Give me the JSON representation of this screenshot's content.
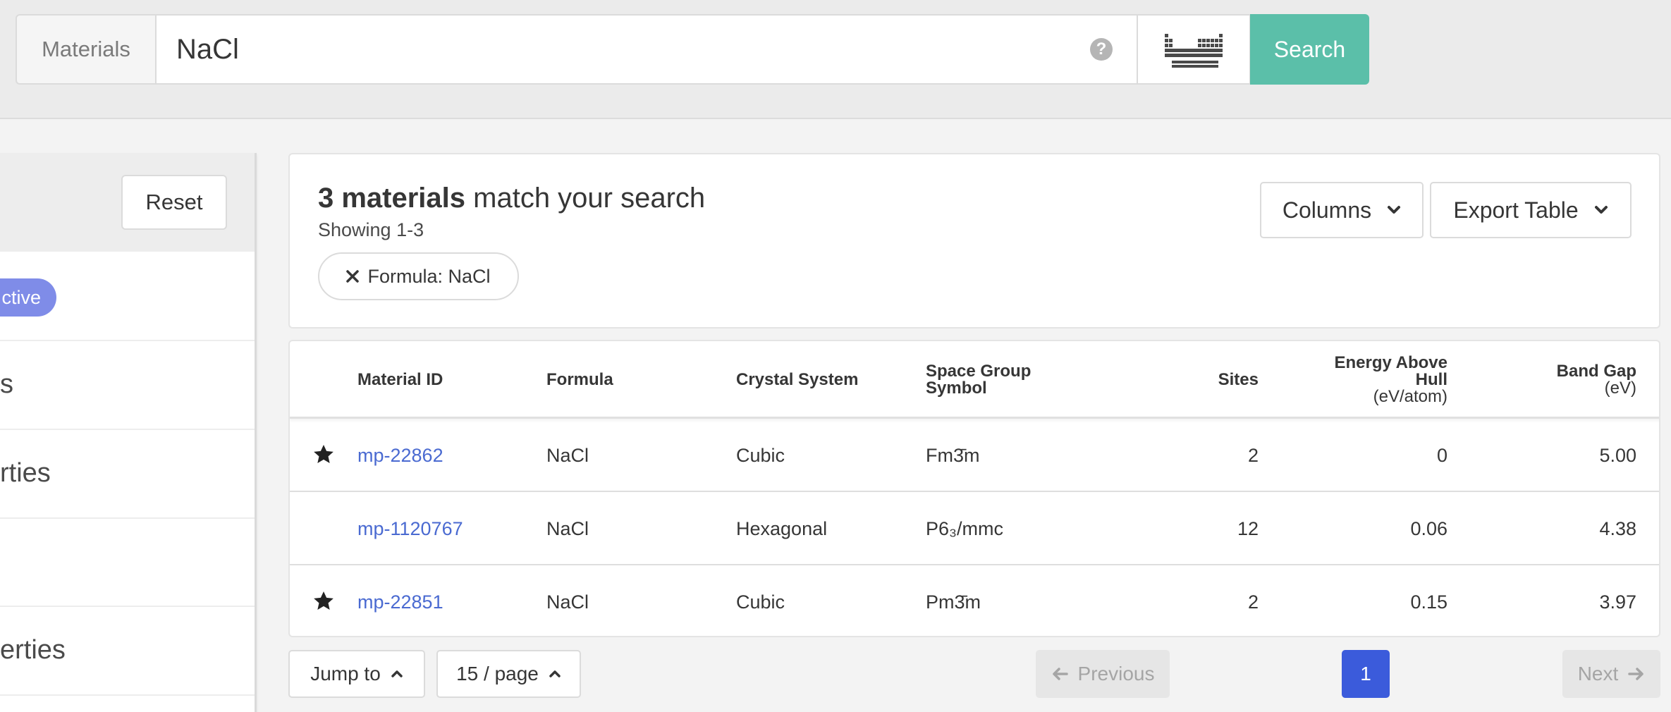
{
  "search": {
    "addon_label": "Materials",
    "query": "NaCl",
    "help_icon": "?",
    "submit_label": "Search"
  },
  "filters": {
    "reset_label": "Reset",
    "active_badge": "ctive",
    "rows": [
      "s",
      "rties",
      "",
      "erties"
    ]
  },
  "results": {
    "count": "3 materials",
    "count_suffix": " match your search",
    "showing": "Showing 1-3",
    "chip_label": "Formula: NaCl",
    "columns_label": "Columns",
    "export_label": "Export Table"
  },
  "table": {
    "headers": {
      "material_id": "Material ID",
      "formula": "Formula",
      "crystal_system": "Crystal System",
      "space_group_1": "Space Group",
      "space_group_2": "Symbol",
      "sites": "Sites",
      "ehull_1": "Energy Above",
      "ehull_2": "Hull",
      "ehull_3": "(eV/atom)",
      "bandgap_1": "Band Gap",
      "bandgap_2": "(eV)"
    },
    "rows": [
      {
        "starred": true,
        "id": "mp-22862",
        "formula": "NaCl",
        "crystal": "Cubic",
        "space_group": "Fm3̄m",
        "sites": "2",
        "ehull": "0",
        "gap": "5.00"
      },
      {
        "starred": false,
        "id": "mp-1120767",
        "formula": "NaCl",
        "crystal": "Hexagonal",
        "space_group": "P6₃/mmc",
        "sites": "12",
        "ehull": "0.06",
        "gap": "4.38"
      },
      {
        "starred": true,
        "id": "mp-22851",
        "formula": "NaCl",
        "crystal": "Cubic",
        "space_group": "Pm3̄m",
        "sites": "2",
        "ehull": "0.15",
        "gap": "3.97"
      }
    ]
  },
  "pagination": {
    "jump_label": "Jump to",
    "per_page_label": "15 / page",
    "previous_label": "Previous",
    "current_page": "1",
    "next_label": "Next"
  },
  "colors": {
    "search_button": "#5bbfa9",
    "link": "#4a6ad1",
    "current_page": "#3b5bdb",
    "active_badge": "#7f8ce8"
  }
}
